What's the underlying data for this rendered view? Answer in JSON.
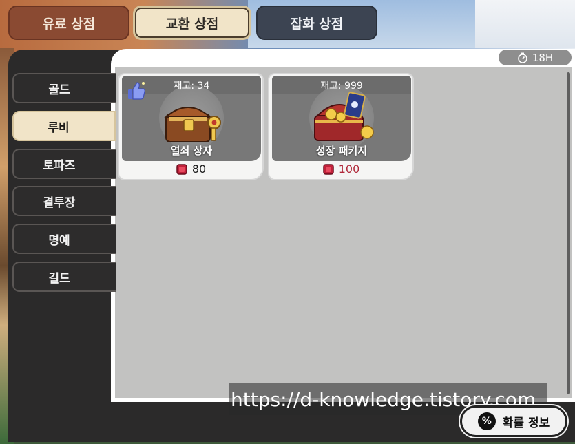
{
  "top_tabs": [
    {
      "label": "유료 상점",
      "active": false
    },
    {
      "label": "교환 상점",
      "active": true
    },
    {
      "label": "잡화 상점",
      "active": false
    }
  ],
  "sidebar": {
    "items": [
      {
        "label": "골드",
        "active": false
      },
      {
        "label": "루비",
        "active": true
      },
      {
        "label": "토파즈",
        "active": false
      },
      {
        "label": "결투장",
        "active": false
      },
      {
        "label": "명예",
        "active": false
      },
      {
        "label": "길드",
        "active": false
      }
    ]
  },
  "timer": {
    "label": "18H",
    "icon": "stopwatch-icon"
  },
  "products": [
    {
      "stock": "재고: 34",
      "name": "열쇠 상자",
      "price": "80",
      "currency_icon": "ruby-icon",
      "recommended": true
    },
    {
      "stock": "재고: 999",
      "name": "성장 패키지",
      "price": "100",
      "currency_icon": "ruby-icon",
      "recommended": false
    }
  ],
  "probability_button": {
    "label": "확률 정보",
    "icon": "percent-icon"
  },
  "watermark": "https://d-knowledge.tistory.com",
  "colors": {
    "active_tab": "#f1e4c8",
    "panel_dark": "#2b2a2a",
    "price_red": "#b0283a"
  }
}
